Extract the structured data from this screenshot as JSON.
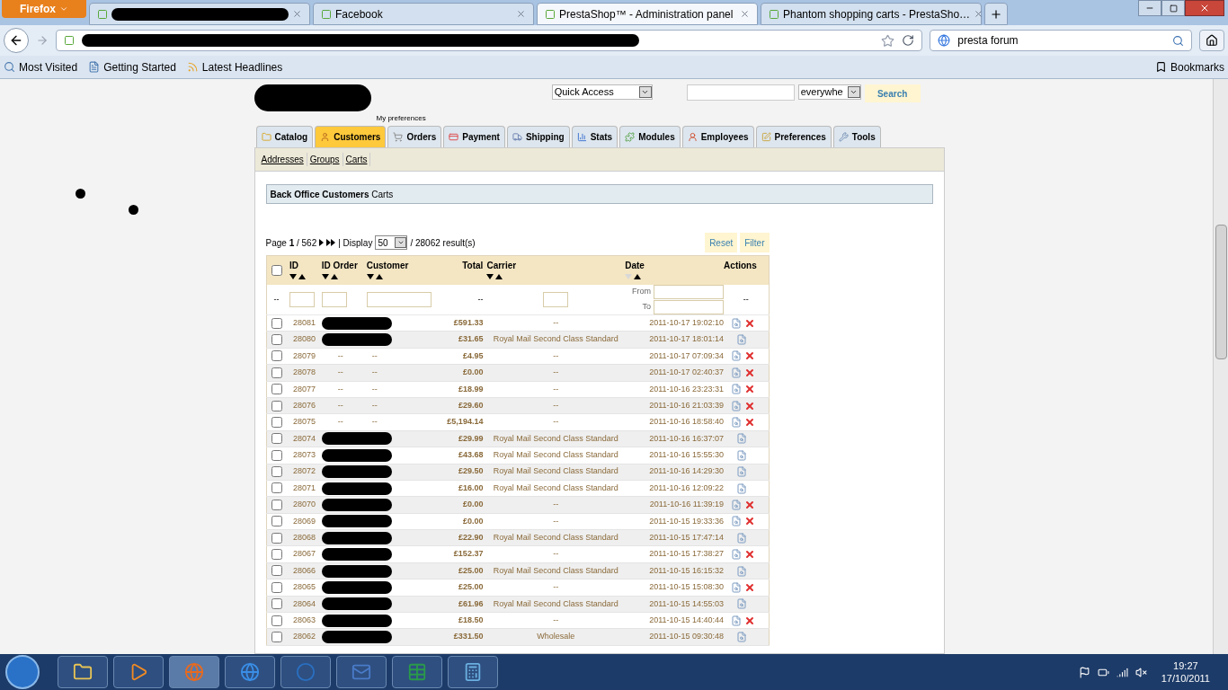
{
  "browser": {
    "menu_button": "Firefox",
    "tabs": [
      {
        "redacted": true,
        "selected": false
      },
      {
        "label": "Facebook",
        "selected": false
      },
      {
        "label": "PrestaShop™ - Administration panel",
        "selected": true
      },
      {
        "label": "Phantom shopping carts - PrestaSho…",
        "selected": false
      }
    ],
    "address": {
      "redacted": true
    },
    "search": {
      "value": "presta forum"
    },
    "bookmarks": [
      "Most Visited",
      "Getting Started",
      "Latest Headlines"
    ],
    "bookmarks_menu": "Bookmarks"
  },
  "header": {
    "preferences_link": "My preferences",
    "quick_access": "Quick Access",
    "search_scope": "everywhe",
    "search_button": "Search"
  },
  "tabs": [
    {
      "label": "Catalog",
      "selected": false
    },
    {
      "label": "Customers",
      "selected": true
    },
    {
      "label": "Orders",
      "selected": false
    },
    {
      "label": "Payment",
      "selected": false
    },
    {
      "label": "Shipping",
      "selected": false
    },
    {
      "label": "Stats",
      "selected": false
    },
    {
      "label": "Modules",
      "selected": false
    },
    {
      "label": "Employees",
      "selected": false
    },
    {
      "label": "Preferences",
      "selected": false
    },
    {
      "label": "Tools",
      "selected": false
    }
  ],
  "subtabs": [
    "Addresses",
    "Groups",
    "Carts"
  ],
  "breadcrumb": "**Back Office Customers** Carts",
  "pagination": {
    "page": "Page **1** / 562",
    "display": "| Display",
    "per_page": "50",
    "results": "/ 28062 result(s)"
  },
  "buttons": [
    "Reset",
    "Filter"
  ],
  "table": {
    "select_all_checked": false,
    "columns": [
      {
        "label": "ID",
        "sortable": true,
        "sorted": false
      },
      {
        "label": "ID Order",
        "sortable": true,
        "sorted": false
      },
      {
        "label": "Customer",
        "sortable": true,
        "sorted": false
      },
      {
        "label": "Total"
      },
      {
        "label": "Carrier",
        "sortable": true,
        "sorted": false
      },
      {
        "label": "Date",
        "sortable": true,
        "sorted": true
      },
      {
        "label": "Actions"
      }
    ],
    "filters": [
      {
        "kind": "text",
        "text": "--"
      },
      {
        "kind": "input"
      },
      {
        "kind": "input"
      },
      {
        "kind": "input"
      },
      {
        "kind": "text",
        "text": "--"
      },
      {
        "kind": "input"
      },
      {
        "kind": "range",
        "from": "From",
        "to": "To"
      },
      {
        "kind": "text",
        "text": "--"
      }
    ],
    "rows": [
      {
        "id": "28081",
        "checked": false,
        "redacted": true,
        "total": "£591.33",
        "carrier": "--",
        "date": "2011-10-17 19:02:10",
        "deletable": true
      },
      {
        "id": "28080",
        "checked": false,
        "redacted": true,
        "total": "£31.65",
        "carrier": "Royal Mail Second Class Standard",
        "date": "2011-10-17 18:01:14",
        "deletable": false
      },
      {
        "id": "28079",
        "checked": false,
        "id_order": "--",
        "customer": "--",
        "total": "£4.95",
        "carrier": "--",
        "date": "2011-10-17 07:09:34",
        "deletable": true
      },
      {
        "id": "28078",
        "checked": false,
        "id_order": "--",
        "customer": "--",
        "total": "£0.00",
        "carrier": "--",
        "date": "2011-10-17 02:40:37",
        "deletable": true
      },
      {
        "id": "28077",
        "checked": false,
        "id_order": "--",
        "customer": "--",
        "total": "£18.99",
        "carrier": "--",
        "date": "2011-10-16 23:23:31",
        "deletable": true
      },
      {
        "id": "28076",
        "checked": false,
        "id_order": "--",
        "customer": "--",
        "total": "£29.60",
        "carrier": "--",
        "date": "2011-10-16 21:03:39",
        "deletable": true
      },
      {
        "id": "28075",
        "checked": false,
        "id_order": "--",
        "customer": "--",
        "total": "£5,194.14",
        "carrier": "--",
        "date": "2011-10-16 18:58:40",
        "deletable": true
      },
      {
        "id": "28074",
        "checked": false,
        "redacted": true,
        "total": "£29.99",
        "carrier": "Royal Mail Second Class Standard",
        "date": "2011-10-16 16:37:07",
        "deletable": false
      },
      {
        "id": "28073",
        "checked": false,
        "redacted": true,
        "total": "£43.68",
        "carrier": "Royal Mail Second Class Standard",
        "date": "2011-10-16 15:55:30",
        "deletable": false
      },
      {
        "id": "28072",
        "checked": false,
        "redacted": true,
        "total": "£29.50",
        "carrier": "Royal Mail Second Class Standard",
        "date": "2011-10-16 14:29:30",
        "deletable": false
      },
      {
        "id": "28071",
        "checked": false,
        "redacted": true,
        "total": "£16.00",
        "carrier": "Royal Mail Second Class Standard",
        "date": "2011-10-16 12:09:22",
        "deletable": false
      },
      {
        "id": "28070",
        "checked": false,
        "redacted": true,
        "total": "£0.00",
        "carrier": "--",
        "date": "2011-10-16 11:39:19",
        "deletable": true
      },
      {
        "id": "28069",
        "checked": false,
        "redacted": true,
        "total": "£0.00",
        "carrier": "--",
        "date": "2011-10-15 19:33:36",
        "deletable": true
      },
      {
        "id": "28068",
        "checked": false,
        "redacted": true,
        "total": "£22.90",
        "carrier": "Royal Mail Second Class Standard",
        "date": "2011-10-15 17:47:14",
        "deletable": false
      },
      {
        "id": "28067",
        "checked": false,
        "redacted": true,
        "total": "£152.37",
        "carrier": "--",
        "date": "2011-10-15 17:38:27",
        "deletable": true
      },
      {
        "id": "28066",
        "checked": false,
        "redacted": true,
        "total": "£25.00",
        "carrier": "Royal Mail Second Class Standard",
        "date": "2011-10-15 16:15:32",
        "deletable": false
      },
      {
        "id": "28065",
        "checked": false,
        "redacted": true,
        "total": "£25.00",
        "carrier": "--",
        "date": "2011-10-15 15:08:30",
        "deletable": true
      },
      {
        "id": "28064",
        "checked": false,
        "redacted": true,
        "total": "£61.96",
        "carrier": "Royal Mail Second Class Standard",
        "date": "2011-10-15 14:55:03",
        "deletable": false
      },
      {
        "id": "28063",
        "checked": false,
        "redacted": true,
        "total": "£18.50",
        "carrier": "--",
        "date": "2011-10-15 14:40:44",
        "deletable": true
      },
      {
        "id": "28062",
        "checked": false,
        "redacted": true,
        "total": "£331.50",
        "carrier": "Wholesale",
        "date": "2011-10-15 09:30:48",
        "deletable": false
      }
    ]
  },
  "taskbar": {
    "apps": [
      {
        "selected": false
      },
      {
        "selected": false
      },
      {
        "selected": true
      },
      {
        "selected": false
      },
      {
        "selected": false
      },
      {
        "selected": false
      },
      {
        "selected": false
      },
      {
        "selected": false
      }
    ],
    "time": "19:27",
    "date": "17/10/2011"
  }
}
